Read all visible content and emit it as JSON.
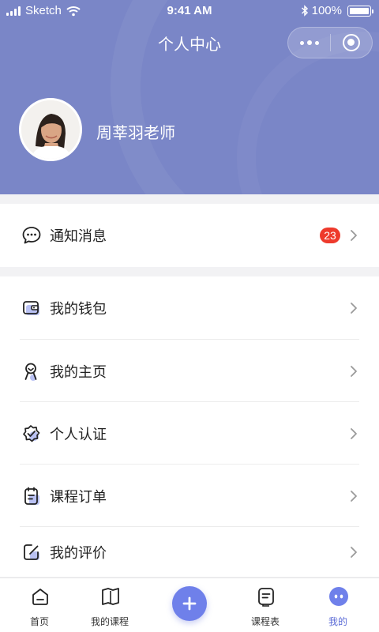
{
  "status_bar": {
    "carrier": "Sketch",
    "time": "9:41 AM",
    "battery": "100%"
  },
  "nav": {
    "title": "个人中心"
  },
  "profile": {
    "name": "周莘羽老师"
  },
  "notifications": {
    "label": "通知消息",
    "badge": "23",
    "icon": "chat-bubble-icon"
  },
  "menu": {
    "items": [
      {
        "label": "我的钱包",
        "icon": "wallet-icon"
      },
      {
        "label": "我的主页",
        "icon": "homepage-icon"
      },
      {
        "label": "个人认证",
        "icon": "verified-badge-icon"
      },
      {
        "label": "课程订单",
        "icon": "clipboard-icon"
      },
      {
        "label": "我的评价",
        "icon": "edit-note-icon"
      }
    ]
  },
  "tabbar": {
    "items": [
      {
        "label": "首页",
        "icon": "home-icon"
      },
      {
        "label": "我的课程",
        "icon": "book-icon"
      },
      {
        "label": "",
        "icon": "plus-icon"
      },
      {
        "label": "课程表",
        "icon": "schedule-icon"
      },
      {
        "label": "我的",
        "icon": "profile-face-icon",
        "active": true
      }
    ]
  },
  "colors": {
    "header_bg": "#7a86c7",
    "accent": "#5b6bd6",
    "badge": "#ee3a2c",
    "icon_highlight": "#b9c1f3"
  }
}
